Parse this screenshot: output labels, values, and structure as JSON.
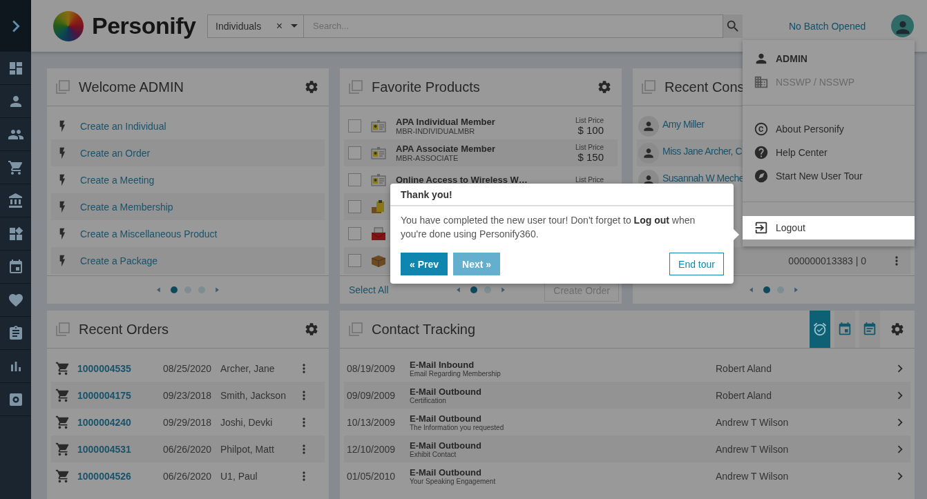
{
  "header": {
    "brand": "Personify",
    "search": {
      "scope": "Individuals",
      "clear": "×",
      "placeholder": "Search..."
    },
    "batch": "No Batch Opened"
  },
  "user_menu": {
    "sections": [
      [
        {
          "kind": "user",
          "label": "ADMIN",
          "disabled": false,
          "highlighted": false
        },
        {
          "kind": "org",
          "label": "NSSWP / NSSWP",
          "disabled": true,
          "highlighted": false
        }
      ],
      [
        {
          "kind": "about",
          "label": "About Personify",
          "disabled": false,
          "highlighted": false
        },
        {
          "kind": "help",
          "label": "Help Center",
          "disabled": false,
          "highlighted": false
        },
        {
          "kind": "tour",
          "label": "Start New User Tour",
          "disabled": false,
          "highlighted": false
        }
      ],
      [
        {
          "kind": "logout",
          "label": "Logout",
          "disabled": false,
          "highlighted": true
        }
      ]
    ]
  },
  "welcome": {
    "title": "Welcome ADMIN",
    "actions": [
      "Create an Individual",
      "Create an Order",
      "Create a Meeting",
      "Create a Membership",
      "Create a Miscellaneous Product",
      "Create a Package"
    ],
    "pages": [
      {
        "selected": true
      },
      {
        "selected": false
      },
      {
        "selected": false
      }
    ]
  },
  "favorite_products": {
    "title": "Favorite Products",
    "items": [
      {
        "kind": "membership",
        "checked": false,
        "name": "APA Individual Member",
        "code": "MBR-INDIVIDUALMBR",
        "price_label": "List Price",
        "price": "$ 100"
      },
      {
        "kind": "membership",
        "checked": false,
        "name": "APA Associate Member",
        "code": "MBR-ASSOCIATE",
        "price_label": "List Price",
        "price": "$ 150"
      },
      {
        "kind": "membership",
        "checked": false,
        "name": "Online Access to Wireless W…",
        "price_label": "List Price"
      },
      {
        "kind": "package",
        "checked": false
      },
      {
        "kind": "email",
        "checked": false
      },
      {
        "kind": "box",
        "checked": false
      }
    ],
    "select_all": "Select All",
    "pages": [
      {
        "selected": true
      },
      {
        "selected": false
      }
    ],
    "create_order": {
      "label": "Create Order",
      "disabled": true
    }
  },
  "recent_constituents": {
    "title": "Recent Cons",
    "items": [
      {
        "name": "Amy Miller"
      },
      {
        "name": "Miss Jane Archer, C"
      },
      {
        "name": "Susannah W Meche"
      }
    ],
    "last_row": {
      "number": "000000013383 | 0"
    },
    "pages": [
      {
        "selected": true
      },
      {
        "selected": false
      }
    ]
  },
  "recent_orders": {
    "title": "Recent Orders",
    "items": [
      {
        "number": "1000004535",
        "date": "08/25/2020",
        "name": "Archer, Jane"
      },
      {
        "number": "1000004175",
        "date": "09/23/2018",
        "name": "Smith, Jackson"
      },
      {
        "number": "1000004240",
        "date": "09/29/2018",
        "name": "Joshi, Devki"
      },
      {
        "number": "1000004531",
        "date": "06/26/2020",
        "name": "Philpot, Matt"
      },
      {
        "number": "1000004526",
        "date": "06/26/2020",
        "name": "U1, Paul"
      }
    ]
  },
  "contact_tracking": {
    "title": "Contact Tracking",
    "views": [
      {
        "kind": "alarm",
        "selected": true
      },
      {
        "kind": "calendar",
        "selected": false
      },
      {
        "kind": "notes",
        "selected": false
      }
    ],
    "rows": [
      {
        "date": "08/19/2009",
        "type": "E-Mail Inbound",
        "subject": "Email Regarding Membership",
        "person": "Robert Aland"
      },
      {
        "date": "09/09/2009",
        "type": "E-Mail Outbound",
        "subject": "Certification",
        "person": "Robert Aland"
      },
      {
        "date": "10/13/2009",
        "type": "E-Mail Outbound",
        "subject": "The Information you requested",
        "person": "Andrew T Wilson"
      },
      {
        "date": "12/10/2009",
        "type": "E-Mail Outbound",
        "subject": "Exhibit Contact",
        "person": "Andrew T Wilson"
      },
      {
        "date": "01/05/2010",
        "type": "E-Mail Outbound",
        "subject": "Your Speaking Engagement",
        "person": "Andrew T Wilson"
      }
    ]
  },
  "tour_popover": {
    "title": "Thank you!",
    "body": "You have completed the new user tour! Don't forget to **Log out** when you're done using Personify360.",
    "prev": {
      "label": "« Prev",
      "disabled": false
    },
    "next": {
      "label": "Next »",
      "disabled": true
    },
    "end": "End tour"
  }
}
